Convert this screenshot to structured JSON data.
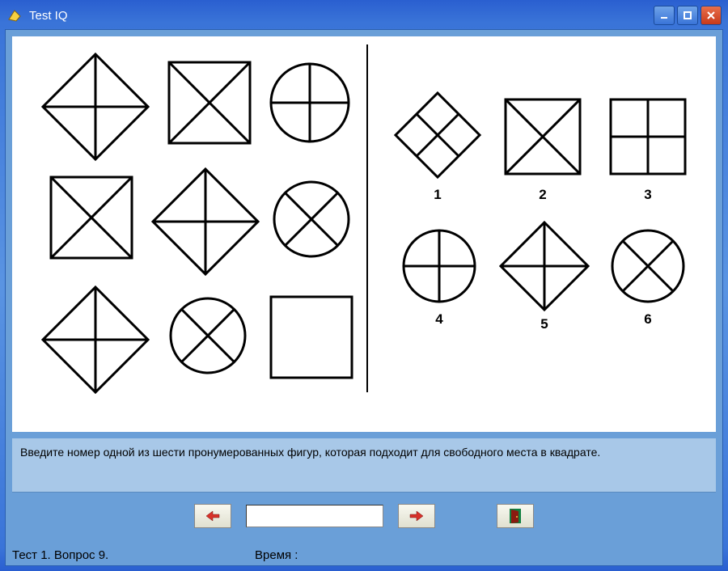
{
  "window": {
    "title": "Test IQ"
  },
  "instruction": "Введите номер одной из шести пронумерованных фигур, которая подходит для свободного места в квадрате.",
  "answer": {
    "value": "",
    "placeholder": ""
  },
  "options": {
    "o1": "1",
    "o2": "2",
    "o3": "3",
    "o4": "4",
    "o5": "5",
    "o6": "6"
  },
  "status": {
    "question": "Тест 1. Вопрос 9.",
    "time_label": "Время :",
    "time_value": ""
  }
}
